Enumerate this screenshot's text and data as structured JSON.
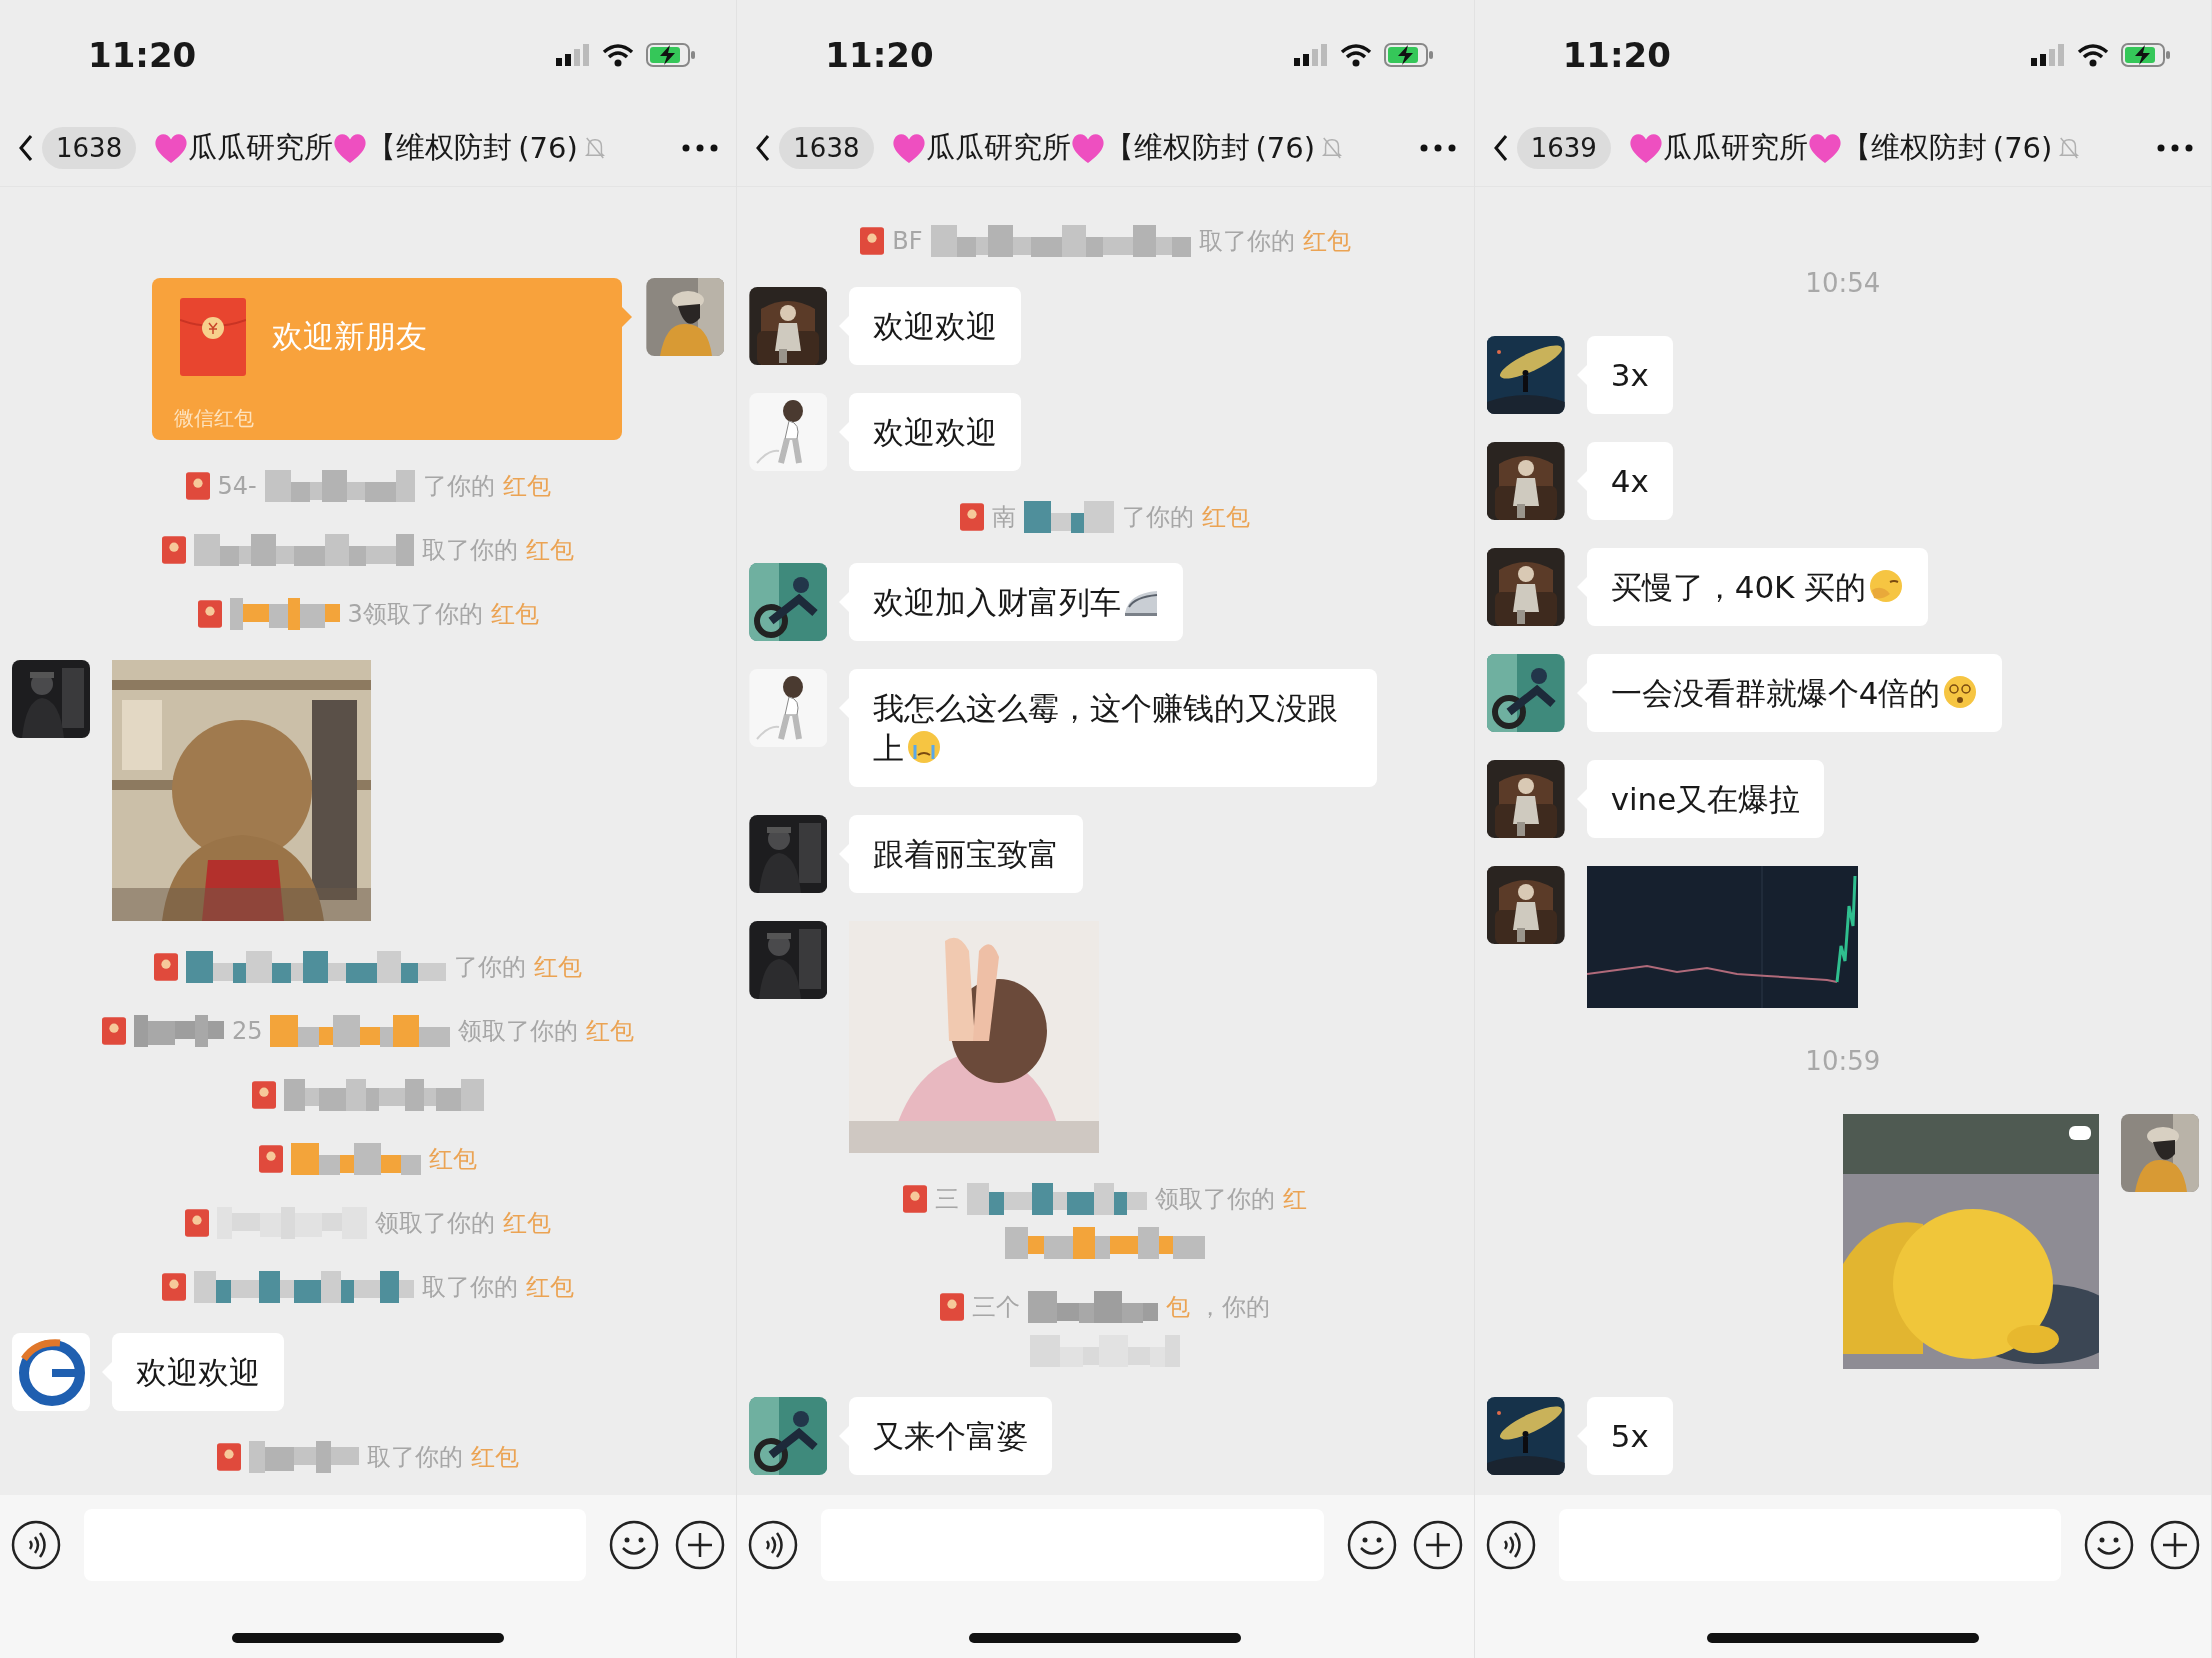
{
  "panels": [
    {
      "status_bar": {
        "time": "11:20"
      },
      "nav": {
        "unread_count": "1638",
        "group_name": "瓜瓜研究所",
        "group_tag": "【维权防封",
        "member_count": "(76)",
        "muted": true
      },
      "messages": [
        {
          "kind": "red_packet",
          "outgoing": true,
          "greeting": "欢迎新朋友",
          "label": "微信红包"
        },
        {
          "kind": "notice",
          "parts": [
            {
              "kind": "text",
              "text": "54-"
            },
            {
              "kind": "mosaic"
            },
            {
              "kind": "text",
              "text": "了你的"
            },
            {
              "kind": "link",
              "text": "红包"
            }
          ]
        },
        {
          "kind": "notice",
          "parts": [
            {
              "kind": "mosaic"
            },
            {
              "kind": "text",
              "text": "取了你的"
            },
            {
              "kind": "link",
              "text": "红包"
            }
          ]
        },
        {
          "kind": "notice",
          "parts": [
            {
              "kind": "mosaic"
            },
            {
              "kind": "text",
              "text": "3领取了你的"
            },
            {
              "kind": "link",
              "text": "红包"
            }
          ]
        },
        {
          "kind": "sticker",
          "outgoing": false
        },
        {
          "kind": "notice",
          "parts": [
            {
              "kind": "mosaic"
            },
            {
              "kind": "text",
              "text": "了你的"
            },
            {
              "kind": "link",
              "text": "红包"
            }
          ]
        },
        {
          "kind": "notice",
          "parts": [
            {
              "kind": "mosaic"
            },
            {
              "kind": "text",
              "text": "25"
            },
            {
              "kind": "mosaic"
            },
            {
              "kind": "text",
              "text": "领取了你的"
            },
            {
              "kind": "link",
              "text": "红包"
            }
          ]
        },
        {
          "kind": "notice",
          "parts": [
            {
              "kind": "mosaic"
            }
          ]
        },
        {
          "kind": "notice",
          "parts": [
            {
              "kind": "mosaic"
            },
            {
              "kind": "link",
              "text": "红包"
            }
          ]
        },
        {
          "kind": "notice",
          "parts": [
            {
              "kind": "mosaic"
            },
            {
              "kind": "text",
              "text": "领取了你的"
            },
            {
              "kind": "link",
              "text": "红包"
            }
          ]
        },
        {
          "kind": "notice",
          "parts": [
            {
              "kind": "mosaic"
            },
            {
              "kind": "text",
              "text": "取了你的"
            },
            {
              "kind": "link",
              "text": "红包"
            }
          ]
        },
        {
          "kind": "text",
          "outgoing": false,
          "text": "欢迎欢迎",
          "emoji": false
        },
        {
          "kind": "notice",
          "parts": [
            {
              "kind": "mosaic"
            },
            {
              "kind": "text",
              "text": "取了你的"
            },
            {
              "kind": "link",
              "text": "红包"
            }
          ]
        }
      ]
    },
    {
      "status_bar": {
        "time": "11:20"
      },
      "nav": {
        "unread_count": "1638",
        "group_name": "瓜瓜研究所",
        "group_tag": "【维权防封",
        "member_count": "(76)",
        "muted": true
      },
      "messages": [
        {
          "kind": "notice",
          "parts": [
            {
              "kind": "text",
              "text": "BF"
            },
            {
              "kind": "mosaic"
            },
            {
              "kind": "text",
              "text": "取了你的"
            },
            {
              "kind": "link",
              "text": "红包"
            }
          ]
        },
        {
          "kind": "text",
          "outgoing": false,
          "text": "欢迎欢迎",
          "emoji": false
        },
        {
          "kind": "text",
          "outgoing": false,
          "text": "欢迎欢迎",
          "emoji": false
        },
        {
          "kind": "notice",
          "parts": [
            {
              "kind": "text",
              "text": "南"
            },
            {
              "kind": "mosaic"
            },
            {
              "kind": "text",
              "text": "了你的"
            },
            {
              "kind": "link",
              "text": "红包"
            }
          ]
        },
        {
          "kind": "text",
          "outgoing": false,
          "text": "欢迎加入财富列车",
          "emoji": true
        },
        {
          "kind": "text",
          "outgoing": false,
          "text": "我怎么这么霉，这个赚钱的又没跟上",
          "emoji": true
        },
        {
          "kind": "text",
          "outgoing": false,
          "text": "跟着丽宝致富",
          "emoji": false
        },
        {
          "kind": "sticker",
          "outgoing": false
        },
        {
          "kind": "notice",
          "mosaic_line": true,
          "parts": [
            {
              "kind": "text",
              "text": "三"
            },
            {
              "kind": "mosaic"
            },
            {
              "kind": "text",
              "text": "领取了你的"
            },
            {
              "kind": "link",
              "text": "红"
            }
          ]
        },
        {
          "kind": "notice",
          "mosaic_line": true,
          "parts": [
            {
              "kind": "text",
              "text": "三个"
            },
            {
              "kind": "mosaic"
            },
            {
              "kind": "link",
              "text": "包"
            },
            {
              "kind": "text",
              "text": "，你的"
            }
          ]
        },
        {
          "kind": "text",
          "outgoing": false,
          "text": "又来个富婆",
          "emoji": false
        }
      ]
    },
    {
      "status_bar": {
        "time": "11:20"
      },
      "nav": {
        "unread_count": "1639",
        "group_name": "瓜瓜研究所",
        "group_tag": "【维权防封",
        "member_count": "(76)",
        "muted": true
      },
      "messages": [
        {
          "kind": "time",
          "text": "10:54"
        },
        {
          "kind": "text",
          "outgoing": false,
          "text": "3x",
          "emoji": false
        },
        {
          "kind": "text",
          "outgoing": false,
          "text": "4x",
          "emoji": false
        },
        {
          "kind": "text",
          "outgoing": false,
          "text": "买慢了，40K 买的",
          "emoji": true
        },
        {
          "kind": "text",
          "outgoing": false,
          "text": "一会没看群就爆个4倍的",
          "emoji": true
        },
        {
          "kind": "text",
          "outgoing": false,
          "text": "vine又在爆拉",
          "emoji": false
        },
        {
          "kind": "sticker",
          "outgoing": false
        },
        {
          "kind": "time",
          "text": "10:59"
        },
        {
          "kind": "sticker",
          "outgoing": true
        },
        {
          "kind": "text",
          "outgoing": false,
          "text": "5x",
          "emoji": false
        }
      ]
    }
  ]
}
